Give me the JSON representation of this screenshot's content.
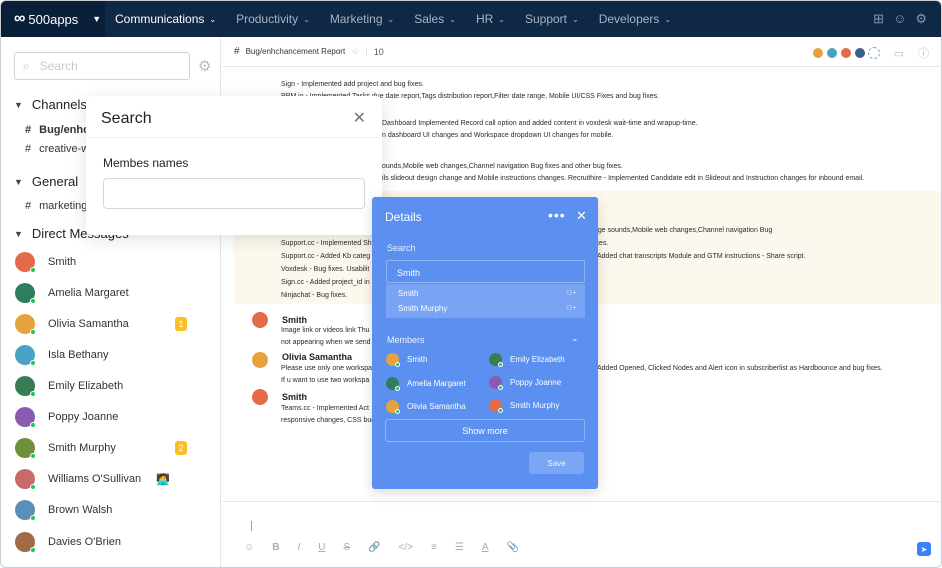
{
  "topnav": {
    "brand": "500apps",
    "items": [
      "Communications",
      "Productivity",
      "Marketing",
      "Sales",
      "HR",
      "Support",
      "Developers"
    ]
  },
  "sidebar": {
    "search_placeholder": "Search",
    "channels_title": "Channels",
    "channels": [
      "Bug/enhch",
      "creative-w"
    ],
    "general_title": "General",
    "general_channels": [
      "marketing"
    ],
    "dm_title": "Direct Messages",
    "dms": [
      {
        "name": "Smith",
        "color": "#e46b4a",
        "badge": ""
      },
      {
        "name": "Amelia Margaret",
        "color": "#2f7d5f",
        "badge": ""
      },
      {
        "name": "Olivia Samantha",
        "color": "#e6a23c",
        "badge": "1"
      },
      {
        "name": "Isla Bethany",
        "color": "#4aa3c7",
        "badge": ""
      },
      {
        "name": "Emily Elizabeth",
        "color": "#3a7d55",
        "badge": ""
      },
      {
        "name": "Poppy Joanne",
        "color": "#8a5bb0",
        "badge": ""
      },
      {
        "name": "Smith Murphy",
        "color": "#6f8f3a",
        "badge": "2"
      },
      {
        "name": "Williams O'Sullivan",
        "color": "#c76a6a",
        "badge": ""
      },
      {
        "name": "Brown Walsh",
        "color": "#5b8fb8",
        "badge": ""
      },
      {
        "name": "Davies O'Brien",
        "color": "#a06b45",
        "badge": ""
      }
    ]
  },
  "channel": {
    "name": "Bug/enhchancement Report",
    "count": "10"
  },
  "messages": {
    "lines": [
      "Sign - Implemented add project and bug fixes.",
      "PPM.io - Implemented Tasks due date report,Tags distribution report,Filter date range, Mobile UI/CSS Fixes and bug fixes.",
      "Dashboard Implemented Record call option and added content in voxdesk wait-time and wrapup-time.",
      "n dashboard UI changes and Workspace dropdown UI changes for mobile.",
      "ounds,Mobile web changes,Channel navigation Bug fixes and other bug fixes.",
      "ils slideout design change and Mobile instructions changes. Recruithire - Implemented Candidate edit in Slideout and Instruction changes for inbound email.",
      "age sounds,Mobile web changes,Channel navigation Bug",
      "ixes.",
      "Support.cc - Implemented Sh",
      "Support.cc - Added Kb categ",
      "Added chat transcripts Module and GTM instructions - Share script.",
      "Voxdesk - Bug fixes. Usabilit",
      "Sign.cc - Added project_id in",
      "Ninjachat - Bug fixes.",
      "Image link or videos link Thu",
      "not appearing when we send",
      "Please use only one workspa",
      "Added Opened, Clicked Nodes and Alert icon in subscriberlist as Hardbounce and bug fixes.",
      "If u want to use two workspa",
      "Teams.cc - Implemented Act",
      "responsive changes, CSS bug"
    ],
    "authors": [
      "Smith",
      "Olivia Samantha",
      "Smith"
    ]
  },
  "search_modal": {
    "title": "Search",
    "label": "Membes names"
  },
  "details": {
    "title": "Details",
    "search_label": "Search",
    "search_value": "Smith",
    "results": [
      "Smith",
      "Smith Murphy"
    ],
    "members_label": "Members",
    "members": [
      "Smith",
      "Emily Elizabeth",
      "Amelia Margaret",
      "Poppy Joanne",
      "Olivia Samantha",
      "Smith Murphy"
    ],
    "show_more": "Show more",
    "save": "Save"
  }
}
